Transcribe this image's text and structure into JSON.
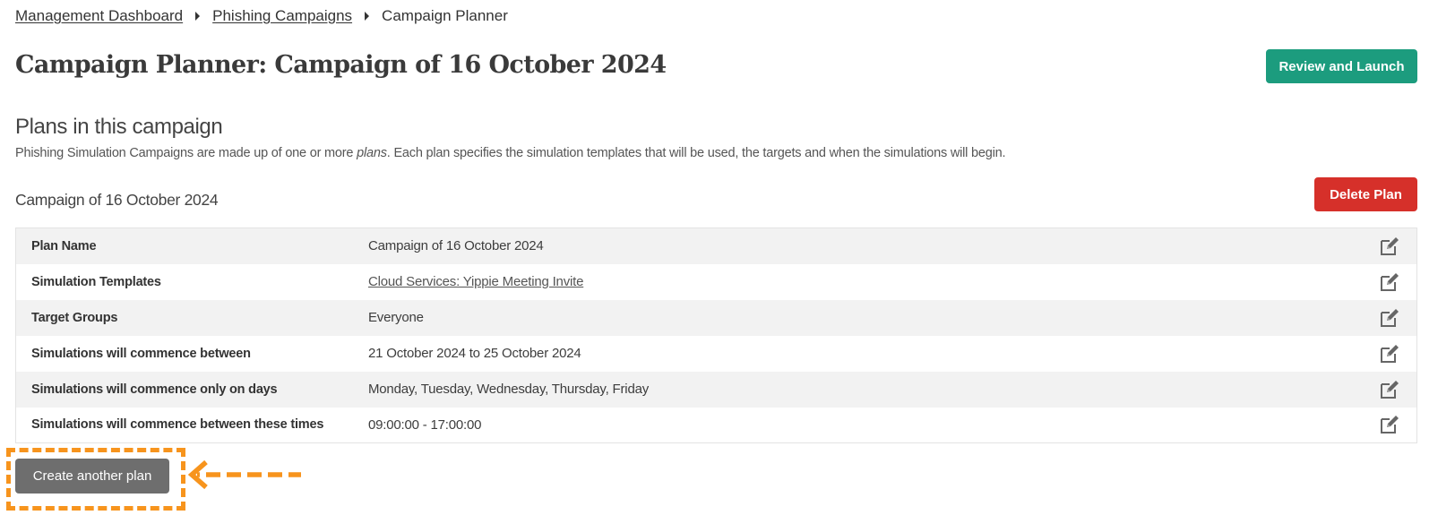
{
  "breadcrumb": {
    "items": [
      {
        "label": "Management Dashboard",
        "link": true
      },
      {
        "label": "Phishing Campaigns",
        "link": true
      },
      {
        "label": "Campaign Planner",
        "link": false
      }
    ]
  },
  "header": {
    "title": "Campaign Planner: Campaign of 16 October 2024",
    "review_launch_label": "Review and Launch"
  },
  "plans_section": {
    "title": "Plans in this campaign",
    "description_before": "Phishing Simulation Campaigns are made up of one or more ",
    "description_emphasis": "plans",
    "description_after": ". Each plan specifies the simulation templates that will be used, the targets and when the simulations will begin."
  },
  "plan": {
    "title": "Campaign of 16 October 2024",
    "delete_label": "Delete Plan",
    "rows": [
      {
        "label": "Plan Name",
        "value": "Campaign of 16 October 2024",
        "is_link": false,
        "icon": "edit-icon"
      },
      {
        "label": "Simulation Templates",
        "value": "Cloud Services: Yippie Meeting Invite",
        "is_link": true,
        "icon": "edit-icon"
      },
      {
        "label": "Target Groups",
        "value": "Everyone",
        "is_link": false,
        "icon": "edit-icon"
      },
      {
        "label": "Simulations will commence between",
        "value": "21 October 2024 to 25 October 2024",
        "is_link": false,
        "icon": "edit-icon"
      },
      {
        "label": "Simulations will commence only on days",
        "value": "Monday, Tuesday, Wednesday, Thursday, Friday",
        "is_link": false,
        "icon": "edit-icon"
      },
      {
        "label": "Simulations will commence between these times",
        "value": "09:00:00 - 17:00:00",
        "is_link": false,
        "icon": "edit-icon"
      }
    ]
  },
  "actions": {
    "create_another_plan_label": "Create another plan"
  },
  "annotation": {
    "highlight_color": "#f7941d",
    "arrow_direction": "left"
  },
  "colors": {
    "launch_button": "#1c9c7e",
    "delete_button": "#d6302a",
    "create_button": "#6e6e6e"
  }
}
